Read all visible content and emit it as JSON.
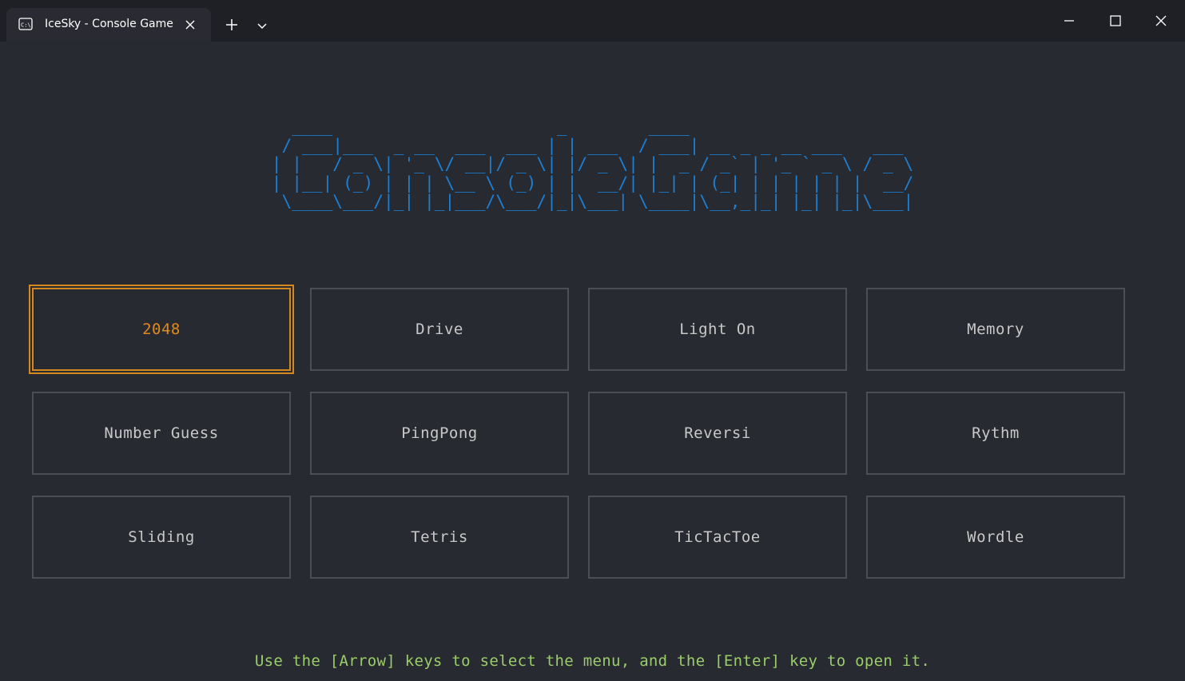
{
  "window": {
    "tab_title": "IceSky - Console Game"
  },
  "banner": {
    "ascii_art": "  ____                      _        ____                      \n / ___|___  _ __  ___  ___ | | ___  / ___| __ _ _ __ ___   ___ \n| |   / _ \\| '_ \\/ __|/ _ \\| |/ _ \\| |  _ / _` | '_ ` _ \\ / _ \\\n| |__| (_) | | | \\__ \\ (_) | |  __/| |_| | (_| | | | | | |  __/\n \\____\\___/|_| |_|___/\\___/|_|\\___| \\____|\\__,_|_| |_| |_|\\___|"
  },
  "menu": {
    "selected_index": 0,
    "items": [
      {
        "label": "2048"
      },
      {
        "label": "Drive"
      },
      {
        "label": "Light On"
      },
      {
        "label": "Memory"
      },
      {
        "label": "Number Guess"
      },
      {
        "label": "PingPong"
      },
      {
        "label": "Reversi"
      },
      {
        "label": "Rythm"
      },
      {
        "label": "Sliding"
      },
      {
        "label": "Tetris"
      },
      {
        "label": "TicTacToe"
      },
      {
        "label": "Wordle"
      }
    ]
  },
  "hint": "Use the [Arrow] keys to select the menu, and the [Enter] key to open it.",
  "colors": {
    "background": "#282a31",
    "titlebar": "#1f2026",
    "banner": "#1e7fd1",
    "selected": "#d4891e",
    "hint": "#9acd68",
    "item_border": "#4d4e55",
    "item_text": "#c8c8c8"
  },
  "icons": {
    "tab": "terminal-icon",
    "close": "close-icon",
    "new_tab": "plus-icon",
    "dropdown": "chevron-down-icon",
    "minimize": "minimize-icon",
    "maximize": "maximize-icon",
    "window_close": "close-icon"
  }
}
